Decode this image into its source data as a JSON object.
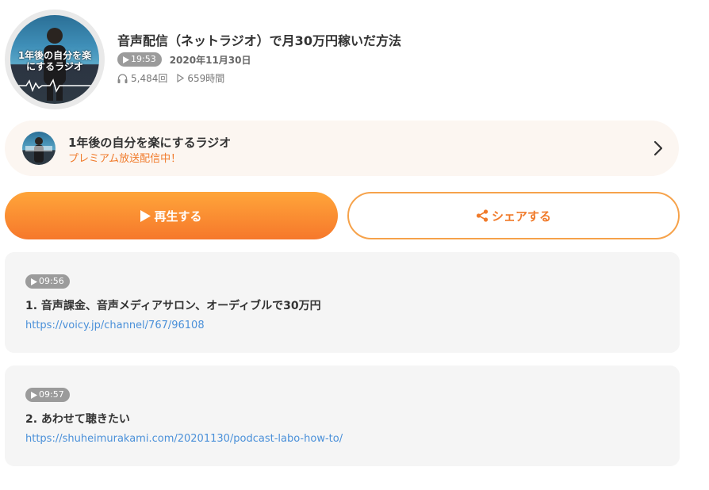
{
  "episode": {
    "title": "音声配信（ネットラジオ）で月30万円稼いだ方法",
    "duration": "19:53",
    "date": "2020年11月30日",
    "plays": "5,484回",
    "listen_time": "659時間",
    "cover_text": "1年後の自分を楽にするラジオ"
  },
  "channel": {
    "name": "1年後の自分を楽にするラジオ",
    "subtitle": "プレミアム放送配信中！"
  },
  "actions": {
    "play_label": "再生する",
    "share_label": "シェアする"
  },
  "chapters": [
    {
      "time": "09:56",
      "title": "1.  音声課金、音声メディアサロン、オーディブルで30万円",
      "link": "https://voicy.jp/channel/767/96108"
    },
    {
      "time": "09:57",
      "title": "2.  あわせて聴きたい",
      "link": "https://shuheimurakami.com/20201130/podcast-labo-how-to/"
    }
  ],
  "colors": {
    "accent": "#f6782b",
    "accent_light": "#ffa53a",
    "link": "#4a90d9",
    "badge": "#9b9b9b"
  },
  "icons": {
    "play": "play-icon",
    "headphones": "headphones-icon",
    "share": "share-icon",
    "chevron": "chevron-right-icon"
  }
}
